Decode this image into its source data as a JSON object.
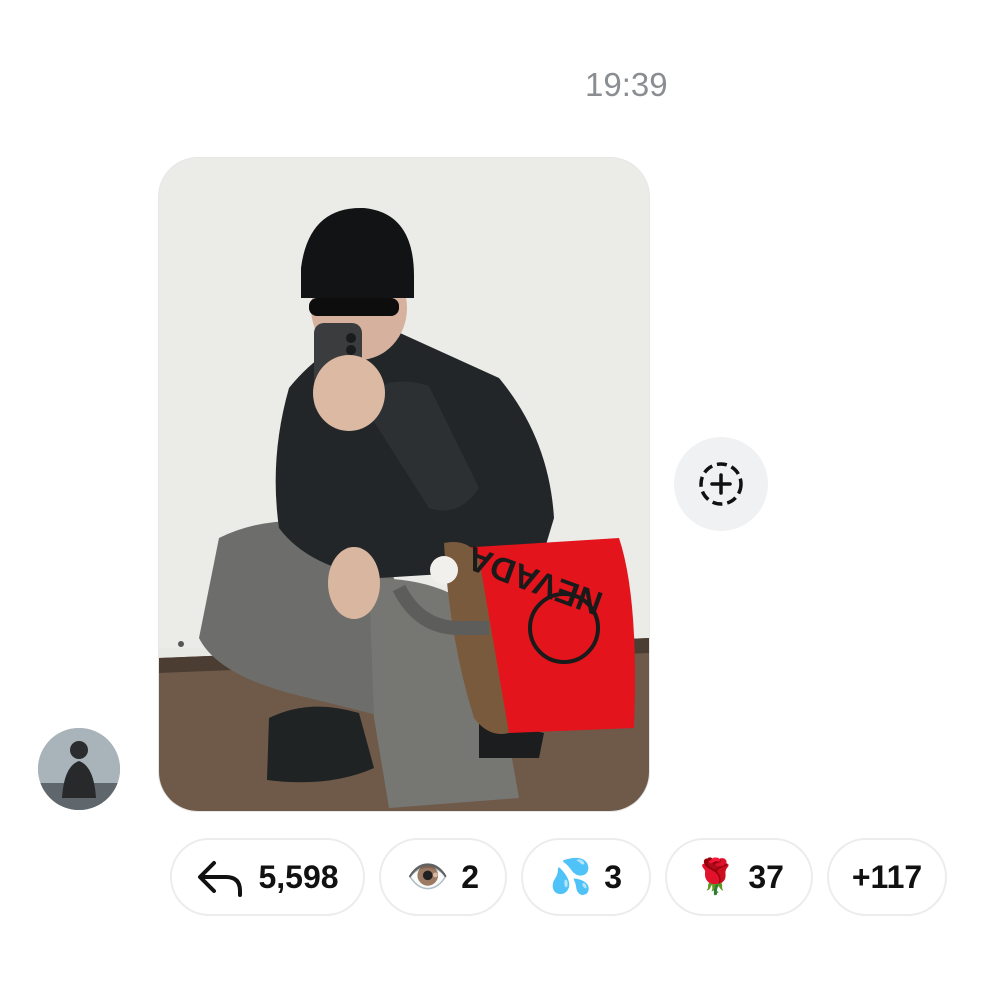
{
  "message": {
    "timestamp": "19:39"
  },
  "photo": {
    "alt_icon": "photo"
  },
  "add_reaction": {
    "icon": "add-reaction-icon"
  },
  "reactions": [
    {
      "icon": "reply-arrow-icon",
      "emoji": "",
      "count": "5,598"
    },
    {
      "icon": "eye-emoji",
      "emoji": "👁️",
      "count": "2"
    },
    {
      "icon": "sweat-droplets-emoji",
      "emoji": "💦",
      "count": "3"
    },
    {
      "icon": "rose-emoji",
      "emoji": "🌹",
      "count": "37"
    },
    {
      "icon": "",
      "emoji": "",
      "count": "+117"
    }
  ],
  "colors": {
    "timestamp": "#8a8d91",
    "pill_border": "#ececec",
    "add_button_bg": "#f0f1f3",
    "bag_red": "#e3141b"
  }
}
